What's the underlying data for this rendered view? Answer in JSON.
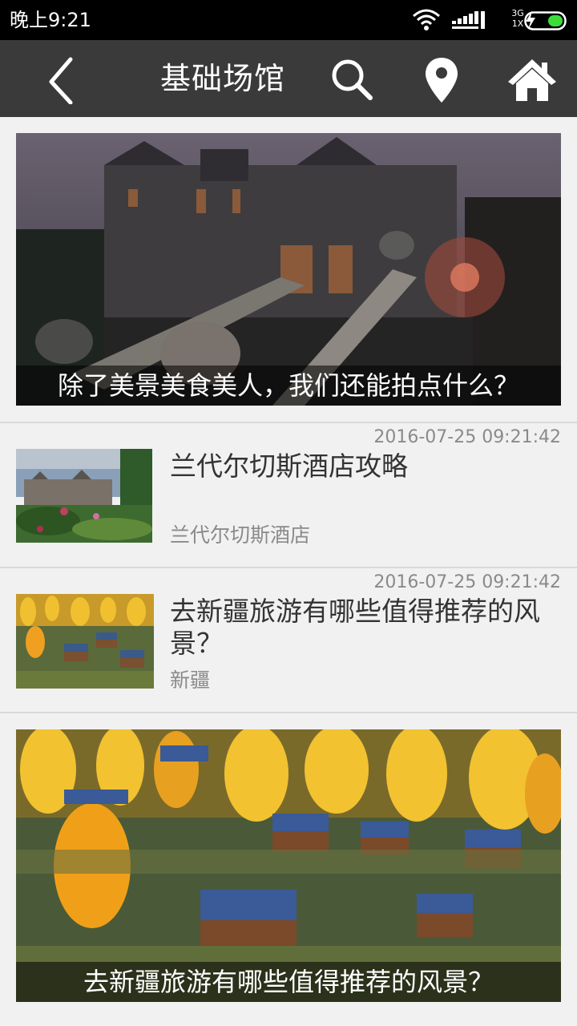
{
  "status_bar": {
    "time": "晚上9:21",
    "network_label_top": "3G",
    "network_label_bottom": "1X",
    "icons": [
      "wifi-icon",
      "signal-icon",
      "charging-icon",
      "battery-icon"
    ]
  },
  "app_bar": {
    "title": "基础场馆",
    "icons": [
      "back-arrow-icon",
      "search-icon",
      "location-pin-icon",
      "home-icon"
    ]
  },
  "feed": {
    "featured_top": {
      "caption": "除了美景美食美人，我们还能拍点什么？"
    },
    "items": [
      {
        "time": "2016-07-25 09:21:42",
        "title": "兰代尔切斯酒店攻略",
        "subtitle": "兰代尔切斯酒店"
      },
      {
        "time": "2016-07-25 09:21:42",
        "title": "去新疆旅游有哪些值得推荐的风景？",
        "subtitle": "新疆"
      }
    ],
    "featured_bottom": {
      "caption": "去新疆旅游有哪些值得推荐的风景？"
    }
  },
  "colors": {
    "app_bar_bg": "#3a3a3a",
    "page_bg": "#f1f1f1",
    "battery_fill": "#3ddc3d"
  }
}
